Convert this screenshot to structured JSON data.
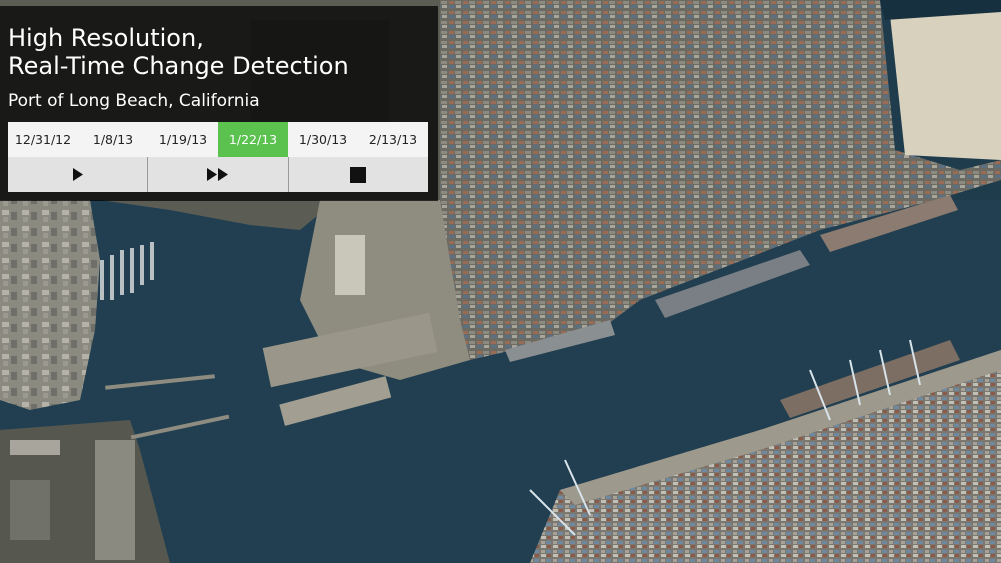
{
  "title": {
    "line1": "High Resolution,",
    "line2": "Real-Time Change Detection"
  },
  "subtitle": "Port of Long Beach, California",
  "dates": [
    {
      "label": "12/31/12",
      "active": false
    },
    {
      "label": "1/8/13",
      "active": false
    },
    {
      "label": "1/19/13",
      "active": false
    },
    {
      "label": "1/22/13",
      "active": true
    },
    {
      "label": "1/30/13",
      "active": false
    },
    {
      "label": "2/13/13",
      "active": false
    }
  ],
  "controls": [
    {
      "icon": "play-icon"
    },
    {
      "icon": "fast-forward-icon"
    },
    {
      "icon": "stop-icon"
    }
  ],
  "colors": {
    "water": "#1f3c4d",
    "active_date": "#5bc250",
    "panel": "rgba(0,0,0,0.72)"
  }
}
